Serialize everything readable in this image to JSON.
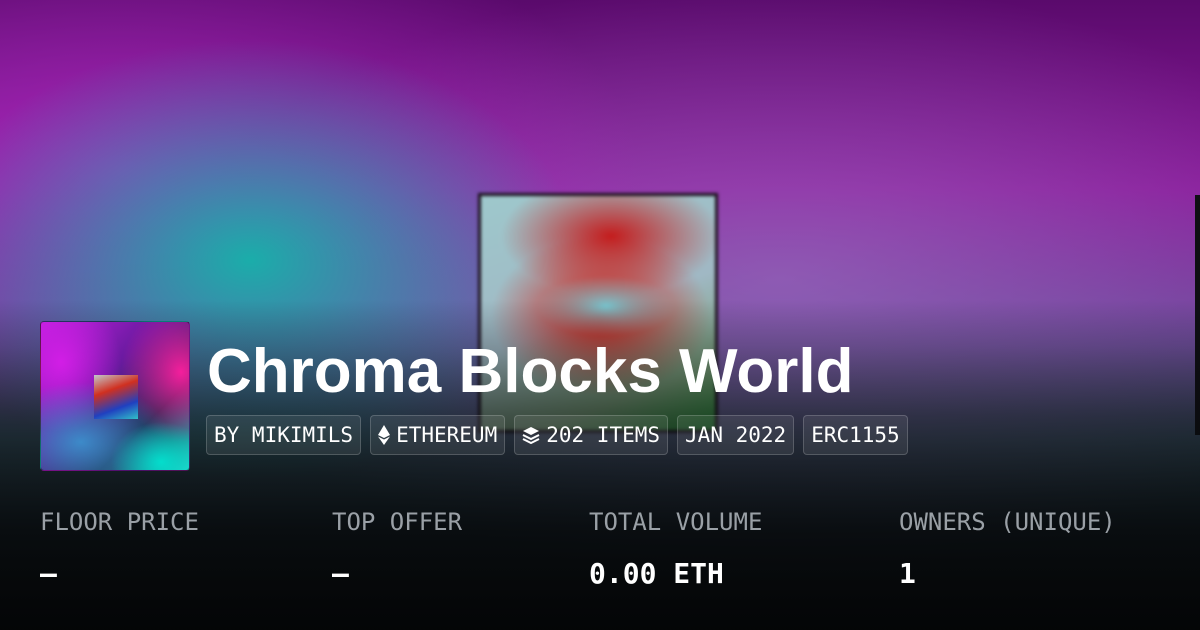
{
  "collection": {
    "name": "Chroma Blocks World",
    "chips": {
      "creator": "BY MIKIMILS",
      "chain": "ETHEREUM",
      "items": "202 ITEMS",
      "date": "JAN 2022",
      "standard": "ERC1155"
    },
    "chip_icons": {
      "chain": "ethereum-icon",
      "items": "layers-icon"
    }
  },
  "stats": [
    {
      "label": "FLOOR PRICE",
      "value": "—"
    },
    {
      "label": "TOP OFFER",
      "value": "—"
    },
    {
      "label": "TOTAL VOLUME",
      "value": "0.00 ETH"
    },
    {
      "label": "OWNERS (UNIQUE)",
      "value": "1"
    }
  ],
  "colors": {
    "text_primary": "#ffffff",
    "text_muted": "#9aa0a6",
    "chip_border": "rgba(255,255,255,0.18)"
  }
}
